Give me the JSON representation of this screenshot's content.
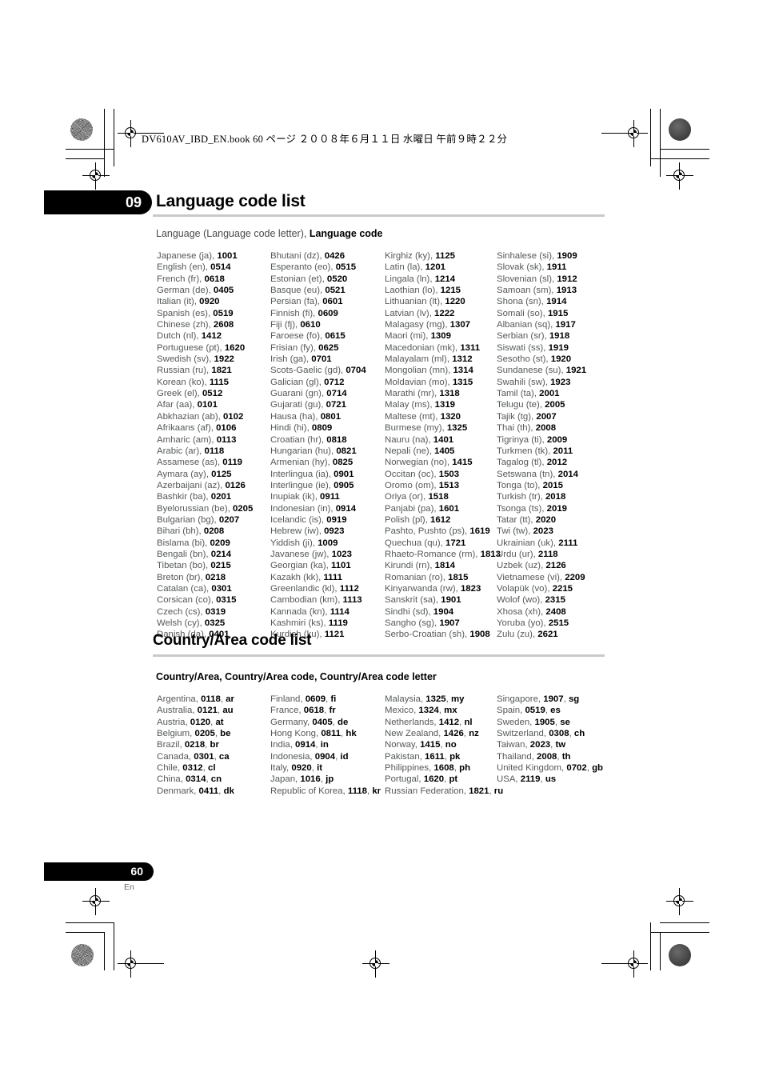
{
  "print_slug": "DV610AV_IBD_EN.book   60 ページ   ２００８年６月１１日   水曜日   午前９時２２分",
  "chapter": {
    "number": "09",
    "title": "Language code list"
  },
  "language_section": {
    "intro_prefix": "Language (Language code letter), ",
    "intro_bold": "Language code",
    "columns": [
      [
        {
          "name": "Japanese (ja), ",
          "code": "1001"
        },
        {
          "name": "English (en), ",
          "code": "0514"
        },
        {
          "name": "French (fr), ",
          "code": "0618"
        },
        {
          "name": "German (de), ",
          "code": "0405"
        },
        {
          "name": "Italian (it), ",
          "code": "0920"
        },
        {
          "name": "Spanish (es), ",
          "code": "0519"
        },
        {
          "name": "Chinese (zh), ",
          "code": "2608"
        },
        {
          "name": "Dutch (nl), ",
          "code": "1412"
        },
        {
          "name": "Portuguese (pt), ",
          "code": "1620"
        },
        {
          "name": "Swedish (sv), ",
          "code": "1922"
        },
        {
          "name": "Russian (ru), ",
          "code": "1821"
        },
        {
          "name": "Korean (ko), ",
          "code": "1115"
        },
        {
          "name": "Greek (el), ",
          "code": "0512"
        },
        {
          "name": "Afar (aa), ",
          "code": "0101"
        },
        {
          "name": "Abkhazian (ab), ",
          "code": "0102"
        },
        {
          "name": "Afrikaans (af), ",
          "code": "0106"
        },
        {
          "name": "Amharic (am), ",
          "code": "0113"
        },
        {
          "name": "Arabic (ar), ",
          "code": "0118"
        },
        {
          "name": "Assamese (as), ",
          "code": "0119"
        },
        {
          "name": "Aymara (ay), ",
          "code": "0125"
        },
        {
          "name": "Azerbaijani (az), ",
          "code": "0126"
        },
        {
          "name": "Bashkir (ba), ",
          "code": "0201"
        },
        {
          "name": "Byelorussian (be), ",
          "code": "0205"
        },
        {
          "name": "Bulgarian (bg), ",
          "code": "0207"
        },
        {
          "name": "Bihari (bh), ",
          "code": "0208"
        },
        {
          "name": "Bislama (bi), ",
          "code": "0209"
        },
        {
          "name": "Bengali (bn), ",
          "code": "0214"
        },
        {
          "name": "Tibetan (bo), ",
          "code": "0215"
        },
        {
          "name": "Breton (br), ",
          "code": "0218"
        },
        {
          "name": "Catalan (ca), ",
          "code": "0301"
        },
        {
          "name": "Corsican (co), ",
          "code": "0315"
        },
        {
          "name": "Czech (cs), ",
          "code": "0319"
        },
        {
          "name": "Welsh (cy), ",
          "code": "0325"
        },
        {
          "name": "Danish (da), ",
          "code": "0401"
        }
      ],
      [
        {
          "name": "Bhutani (dz), ",
          "code": "0426"
        },
        {
          "name": "Esperanto (eo), ",
          "code": "0515"
        },
        {
          "name": "Estonian (et), ",
          "code": "0520"
        },
        {
          "name": "Basque (eu), ",
          "code": "0521"
        },
        {
          "name": "Persian (fa), ",
          "code": "0601"
        },
        {
          "name": "Finnish (fi), ",
          "code": "0609"
        },
        {
          "name": "Fiji (fj), ",
          "code": "0610"
        },
        {
          "name": "Faroese (fo), ",
          "code": "0615"
        },
        {
          "name": "Frisian (fy), ",
          "code": "0625"
        },
        {
          "name": "Irish (ga), ",
          "code": "0701"
        },
        {
          "name": "Scots-Gaelic (gd), ",
          "code": "0704"
        },
        {
          "name": "Galician (gl), ",
          "code": "0712"
        },
        {
          "name": "Guarani (gn), ",
          "code": "0714"
        },
        {
          "name": "Gujarati (gu), ",
          "code": "0721"
        },
        {
          "name": "Hausa (ha), ",
          "code": "0801"
        },
        {
          "name": "Hindi (hi), ",
          "code": "0809"
        },
        {
          "name": "Croatian (hr), ",
          "code": "0818"
        },
        {
          "name": "Hungarian (hu), ",
          "code": "0821"
        },
        {
          "name": "Armenian (hy), ",
          "code": "0825"
        },
        {
          "name": "Interlingua (ia), ",
          "code": "0901"
        },
        {
          "name": "Interlingue (ie), ",
          "code": "0905"
        },
        {
          "name": "Inupiak (ik), ",
          "code": "0911"
        },
        {
          "name": "Indonesian (in), ",
          "code": "0914"
        },
        {
          "name": "Icelandic (is), ",
          "code": "0919"
        },
        {
          "name": "Hebrew (iw), ",
          "code": "0923"
        },
        {
          "name": "Yiddish (ji), ",
          "code": "1009"
        },
        {
          "name": "Javanese (jw), ",
          "code": "1023"
        },
        {
          "name": "Georgian (ka), ",
          "code": "1101"
        },
        {
          "name": "Kazakh (kk), ",
          "code": "1111"
        },
        {
          "name": "Greenlandic (kl), ",
          "code": "1112"
        },
        {
          "name": "Cambodian (km), ",
          "code": "1113"
        },
        {
          "name": "Kannada (kn), ",
          "code": "1114"
        },
        {
          "name": "Kashmiri (ks), ",
          "code": "1119"
        },
        {
          "name": "Kurdish (ku), ",
          "code": "1121"
        }
      ],
      [
        {
          "name": "Kirghiz (ky), ",
          "code": "1125"
        },
        {
          "name": "Latin (la), ",
          "code": "1201"
        },
        {
          "name": "Lingala (ln), ",
          "code": "1214"
        },
        {
          "name": "Laothian (lo), ",
          "code": "1215"
        },
        {
          "name": "Lithuanian (lt), ",
          "code": "1220"
        },
        {
          "name": "Latvian (lv), ",
          "code": "1222"
        },
        {
          "name": "Malagasy (mg), ",
          "code": "1307"
        },
        {
          "name": "Maori (mi), ",
          "code": "1309"
        },
        {
          "name": "Macedonian (mk), ",
          "code": "1311"
        },
        {
          "name": "Malayalam (ml), ",
          "code": "1312"
        },
        {
          "name": "Mongolian (mn), ",
          "code": "1314"
        },
        {
          "name": "Moldavian (mo), ",
          "code": "1315"
        },
        {
          "name": "Marathi (mr), ",
          "code": "1318"
        },
        {
          "name": "Malay (ms), ",
          "code": "1319"
        },
        {
          "name": "Maltese (mt), ",
          "code": "1320"
        },
        {
          "name": "Burmese (my), ",
          "code": "1325"
        },
        {
          "name": "Nauru (na), ",
          "code": "1401"
        },
        {
          "name": "Nepali (ne), ",
          "code": "1405"
        },
        {
          "name": "Norwegian (no), ",
          "code": "1415"
        },
        {
          "name": "Occitan (oc), ",
          "code": "1503"
        },
        {
          "name": "Oromo (om), ",
          "code": "1513"
        },
        {
          "name": "Oriya (or), ",
          "code": "1518"
        },
        {
          "name": "Panjabi (pa), ",
          "code": "1601"
        },
        {
          "name": "Polish (pl), ",
          "code": "1612"
        },
        {
          "name": "Pashto, Pushto (ps), ",
          "code": "1619"
        },
        {
          "name": "Quechua (qu), ",
          "code": "1721"
        },
        {
          "name": "Rhaeto-Romance (rm), ",
          "code": "1813"
        },
        {
          "name": "Kirundi (rn), ",
          "code": "1814"
        },
        {
          "name": "Romanian (ro), ",
          "code": "1815"
        },
        {
          "name": "Kinyarwanda (rw), ",
          "code": "1823"
        },
        {
          "name": "Sanskrit (sa), ",
          "code": "1901"
        },
        {
          "name": "Sindhi (sd), ",
          "code": "1904"
        },
        {
          "name": "Sangho (sg), ",
          "code": "1907"
        },
        {
          "name": "Serbo-Croatian (sh), ",
          "code": "1908"
        }
      ],
      [
        {
          "name": "Sinhalese (si), ",
          "code": "1909"
        },
        {
          "name": "Slovak (sk), ",
          "code": "1911"
        },
        {
          "name": "Slovenian (sl), ",
          "code": "1912"
        },
        {
          "name": "Samoan (sm), ",
          "code": "1913"
        },
        {
          "name": "Shona (sn), ",
          "code": "1914"
        },
        {
          "name": "Somali (so), ",
          "code": "1915"
        },
        {
          "name": "Albanian (sq), ",
          "code": "1917"
        },
        {
          "name": "Serbian (sr), ",
          "code": "1918"
        },
        {
          "name": "Siswati (ss), ",
          "code": "1919"
        },
        {
          "name": "Sesotho (st), ",
          "code": "1920"
        },
        {
          "name": "Sundanese (su), ",
          "code": "1921"
        },
        {
          "name": "Swahili (sw), ",
          "code": "1923"
        },
        {
          "name": "Tamil (ta), ",
          "code": "2001"
        },
        {
          "name": "Telugu (te), ",
          "code": "2005"
        },
        {
          "name": "Tajik (tg), ",
          "code": "2007"
        },
        {
          "name": "Thai (th), ",
          "code": "2008"
        },
        {
          "name": "Tigrinya (ti), ",
          "code": "2009"
        },
        {
          "name": "Turkmen (tk), ",
          "code": "2011"
        },
        {
          "name": "Tagalog (tl), ",
          "code": "2012"
        },
        {
          "name": "Setswana (tn), ",
          "code": "2014"
        },
        {
          "name": "Tonga (to), ",
          "code": "2015"
        },
        {
          "name": "Turkish (tr), ",
          "code": "2018"
        },
        {
          "name": "Tsonga (ts), ",
          "code": "2019"
        },
        {
          "name": "Tatar (tt), ",
          "code": "2020"
        },
        {
          "name": "Twi (tw), ",
          "code": "2023"
        },
        {
          "name": "Ukrainian (uk), ",
          "code": "2111"
        },
        {
          "name": "Urdu (ur), ",
          "code": "2118"
        },
        {
          "name": "Uzbek (uz), ",
          "code": "2126"
        },
        {
          "name": "Vietnamese (vi), ",
          "code": "2209"
        },
        {
          "name": "Volapük (vo), ",
          "code": "2215"
        },
        {
          "name": "Wolof (wo), ",
          "code": "2315"
        },
        {
          "name": "Xhosa (xh), ",
          "code": "2408"
        },
        {
          "name": "Yoruba (yo), ",
          "code": "2515"
        },
        {
          "name": "Zulu (zu), ",
          "code": "2621"
        }
      ]
    ]
  },
  "country_section": {
    "title": "Country/Area code list",
    "intro": "Country/Area, Country/Area code, Country/Area code letter",
    "columns": [
      [
        {
          "name": "Argentina, ",
          "code": "0118",
          "letter": "ar"
        },
        {
          "name": "Australia, ",
          "code": "0121",
          "letter": "au"
        },
        {
          "name": "Austria, ",
          "code": "0120",
          "letter": "at"
        },
        {
          "name": "Belgium, ",
          "code": "0205",
          "letter": "be"
        },
        {
          "name": "Brazil, ",
          "code": "0218",
          "letter": "br"
        },
        {
          "name": "Canada, ",
          "code": "0301",
          "letter": "ca"
        },
        {
          "name": "Chile, ",
          "code": "0312",
          "letter": "cl"
        },
        {
          "name": "China, ",
          "code": "0314",
          "letter": "cn"
        },
        {
          "name": "Denmark, ",
          "code": "0411",
          "letter": "dk"
        }
      ],
      [
        {
          "name": "Finland, ",
          "code": "0609",
          "letter": "fi"
        },
        {
          "name": "France, ",
          "code": "0618",
          "letter": "fr"
        },
        {
          "name": "Germany, ",
          "code": "0405",
          "letter": "de"
        },
        {
          "name": "Hong Kong, ",
          "code": "0811",
          "letter": "hk"
        },
        {
          "name": "India, ",
          "code": "0914",
          "letter": "in"
        },
        {
          "name": "Indonesia, ",
          "code": "0904",
          "letter": "id"
        },
        {
          "name": "Italy, ",
          "code": "0920",
          "letter": "it"
        },
        {
          "name": "Japan, ",
          "code": "1016",
          "letter": "jp"
        },
        {
          "name": "Republic of Korea, ",
          "code": "1118",
          "letter": "kr"
        }
      ],
      [
        {
          "name": "Malaysia, ",
          "code": "1325",
          "letter": "my"
        },
        {
          "name": "Mexico, ",
          "code": "1324",
          "letter": "mx"
        },
        {
          "name": "Netherlands, ",
          "code": "1412",
          "letter": "nl"
        },
        {
          "name": "New Zealand, ",
          "code": "1426",
          "letter": "nz"
        },
        {
          "name": "Norway, ",
          "code": "1415",
          "letter": "no"
        },
        {
          "name": "Pakistan, ",
          "code": "1611",
          "letter": "pk"
        },
        {
          "name": "Philippines, ",
          "code": "1608",
          "letter": "ph"
        },
        {
          "name": "Portugal, ",
          "code": "1620",
          "letter": "pt"
        },
        {
          "name": "Russian Federation, ",
          "code": "1821",
          "letter": "ru"
        }
      ],
      [
        {
          "name": "Singapore, ",
          "code": "1907",
          "letter": "sg"
        },
        {
          "name": "Spain, ",
          "code": "0519",
          "letter": "es"
        },
        {
          "name": "Sweden, ",
          "code": "1905",
          "letter": "se"
        },
        {
          "name": "Switzerland, ",
          "code": "0308",
          "letter": "ch"
        },
        {
          "name": "Taiwan, ",
          "code": "2023",
          "letter": "tw"
        },
        {
          "name": "Thailand, ",
          "code": "2008",
          "letter": "th"
        },
        {
          "name": "United Kingdom, ",
          "code": "0702",
          "letter": "gb"
        },
        {
          "name": "USA, ",
          "code": "2119",
          "letter": "us"
        }
      ]
    ]
  },
  "footer": {
    "page_number": "60",
    "language": "En"
  }
}
